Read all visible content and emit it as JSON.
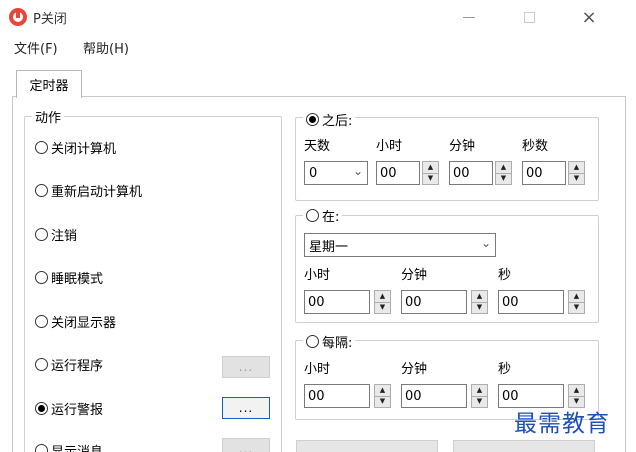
{
  "window": {
    "title": "P关闭",
    "icon": "power-icon",
    "controls": {
      "minimize": "minimize-icon",
      "maximize": "maximize-icon",
      "close": "×"
    }
  },
  "menu": {
    "file": "文件(F)",
    "help": "帮助(H)"
  },
  "tabs": {
    "timer": "定时器"
  },
  "action": {
    "caption": "动作",
    "options": [
      {
        "label": "关闭计算机",
        "checked": false
      },
      {
        "label": "重新启动计算机",
        "checked": false
      },
      {
        "label": "注销",
        "checked": false
      },
      {
        "label": "睡眠模式",
        "checked": false
      },
      {
        "label": "关闭显示器",
        "checked": false
      },
      {
        "label": "运行程序",
        "checked": false
      },
      {
        "label": "运行警报",
        "checked": true
      },
      {
        "label": "显示消息",
        "checked": false
      }
    ],
    "browse_label": "..."
  },
  "after": {
    "caption": "之后:",
    "checked": true,
    "labels": {
      "days": "天数",
      "hours": "小时",
      "minutes": "分钟",
      "seconds": "秒数"
    },
    "values": {
      "days": "0",
      "hours": "00",
      "minutes": "00",
      "seconds": "00"
    }
  },
  "at": {
    "caption": "在:",
    "checked": false,
    "day": "星期一",
    "labels": {
      "hours": "小时",
      "minutes": "分钟",
      "seconds": "秒"
    },
    "values": {
      "hours": "00",
      "minutes": "00",
      "seconds": "00"
    }
  },
  "every": {
    "caption": "每隔:",
    "checked": false,
    "labels": {
      "hours": "小时",
      "minutes": "分钟",
      "seconds": "秒"
    },
    "values": {
      "hours": "00",
      "minutes": "00",
      "seconds": "00"
    }
  },
  "watermark": "最需教育"
}
